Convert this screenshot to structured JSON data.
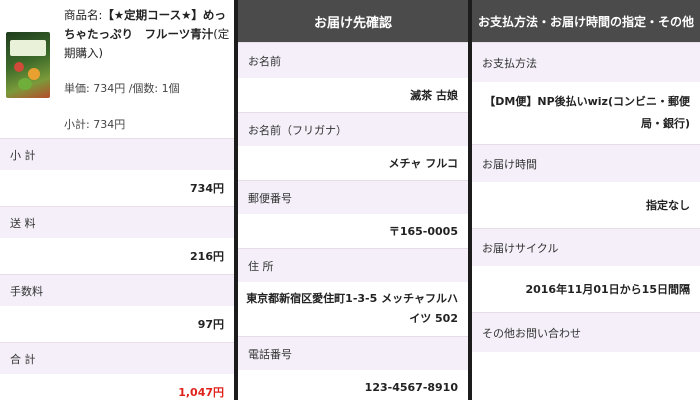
{
  "cart": {
    "product_name_label": "商品名:",
    "product_name": "【★定期コース★】めっちゃたっぷり　フルーツ青汁",
    "product_suffix": "(定期購入)",
    "unit_label": "単価:",
    "unit_price": "734円",
    "qty_label": "/個数:",
    "quantity": "1個",
    "subtotal_line_label": "小計:",
    "subtotal_line_value": "734円",
    "rows": [
      {
        "label": "小 計",
        "value": "734円"
      },
      {
        "label": "送 料",
        "value": "216円"
      },
      {
        "label": "手数料",
        "value": "97円"
      },
      {
        "label": "合 計",
        "value": "1,047円"
      }
    ],
    "total_color": "#e0221c"
  },
  "delivery": {
    "title": "お届け先確認",
    "rows": [
      {
        "label": "お名前",
        "value": "滅茶 古娘"
      },
      {
        "label": "お名前（フリガナ）",
        "value": "メチャ フルコ"
      },
      {
        "label": "郵便番号",
        "value": "〒165-0005"
      },
      {
        "label": "住 所",
        "value": "東京都新宿区愛住町1-3-5 メッチャフルハイツ 502"
      },
      {
        "label": "電話番号",
        "value": "123-4567-8910"
      }
    ]
  },
  "payment": {
    "title": "お支払方法・お届け時間の指定・その他",
    "rows": [
      {
        "label": "お支払方法",
        "value": "【DM便】NP後払いwiz(コンビニ・郵便局・銀行)"
      },
      {
        "label": "お届け時間",
        "value": "指定なし"
      },
      {
        "label": "お届けサイクル",
        "value": "2016年11月01日から15日間隔"
      },
      {
        "label": "その他お問い合わせ",
        "value": ""
      }
    ]
  },
  "colors": {
    "header_bg": "#4b4b4b",
    "label_bg": "#f4eff8",
    "divider": "#1c1c1c"
  }
}
